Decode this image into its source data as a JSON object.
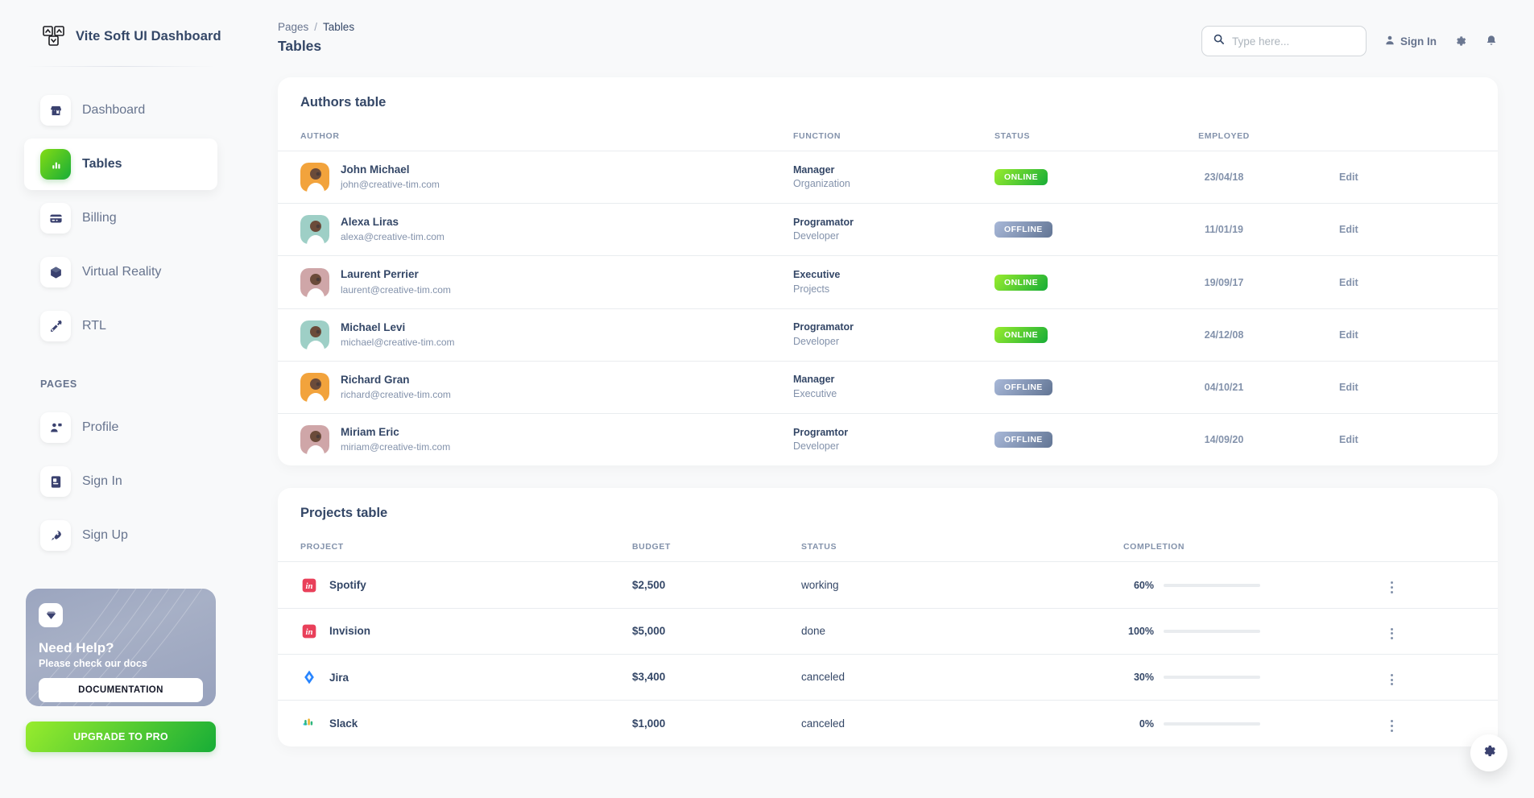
{
  "brand": {
    "name": "Vite Soft UI Dashboard",
    "logo_icon": "vite-logo-icon"
  },
  "sidebar": {
    "items": [
      {
        "label": "Dashboard",
        "icon": "shop-icon",
        "active": false
      },
      {
        "label": "Tables",
        "icon": "chart-bar-icon",
        "active": true
      },
      {
        "label": "Billing",
        "icon": "credit-card-icon",
        "active": false
      },
      {
        "label": "Virtual Reality",
        "icon": "box-3d-icon",
        "active": false
      },
      {
        "label": "RTL",
        "icon": "tools-icon",
        "active": false
      }
    ],
    "section_label": "PAGES",
    "pages": [
      {
        "label": "Profile",
        "icon": "profile-person-icon"
      },
      {
        "label": "Sign In",
        "icon": "document-sign-in-icon"
      },
      {
        "label": "Sign Up",
        "icon": "rocket-icon"
      }
    ],
    "help_card": {
      "icon": "diamond-icon",
      "title": "Need Help?",
      "subtitle": "Please check our docs",
      "button": "DOCUMENTATION"
    },
    "upgrade_button": "UPGRADE TO PRO"
  },
  "header": {
    "breadcrumb": {
      "root": "Pages",
      "separator": "/",
      "current": "Tables"
    },
    "page_title": "Tables",
    "search": {
      "placeholder": "Type here...",
      "value": "",
      "icon": "search-icon"
    },
    "sign_in_label": "Sign In",
    "settings_icon": "gear-icon",
    "notifications_icon": "bell-icon"
  },
  "authors_table": {
    "title": "Authors table",
    "columns": [
      "AUTHOR",
      "FUNCTION",
      "STATUS",
      "EMPLOYED",
      ""
    ],
    "action_label": "Edit",
    "rows": [
      {
        "name": "John Michael",
        "email": "john@creative-tim.com",
        "function": "Manager",
        "department": "Organization",
        "status": "ONLINE",
        "employed": "23/04/18",
        "avatar_bg": "#f2a33c"
      },
      {
        "name": "Alexa Liras",
        "email": "alexa@creative-tim.com",
        "function": "Programator",
        "department": "Developer",
        "status": "OFFLINE",
        "employed": "11/01/19",
        "avatar_bg": "#9ecfc6"
      },
      {
        "name": "Laurent Perrier",
        "email": "laurent@creative-tim.com",
        "function": "Executive",
        "department": "Projects",
        "status": "ONLINE",
        "employed": "19/09/17",
        "avatar_bg": "#cfa6a8"
      },
      {
        "name": "Michael Levi",
        "email": "michael@creative-tim.com",
        "function": "Programator",
        "department": "Developer",
        "status": "ONLINE",
        "employed": "24/12/08",
        "avatar_bg": "#9ecfc6"
      },
      {
        "name": "Richard Gran",
        "email": "richard@creative-tim.com",
        "function": "Manager",
        "department": "Executive",
        "status": "OFFLINE",
        "employed": "04/10/21",
        "avatar_bg": "#f2a33c"
      },
      {
        "name": "Miriam Eric",
        "email": "miriam@creative-tim.com",
        "function": "Programtor",
        "department": "Developer",
        "status": "OFFLINE",
        "employed": "14/09/20",
        "avatar_bg": "#cfa6a8"
      }
    ]
  },
  "projects_table": {
    "title": "Projects table",
    "columns": [
      "PROJECT",
      "BUDGET",
      "STATUS",
      "COMPLETION",
      ""
    ],
    "rows": [
      {
        "name": "Spotify",
        "icon": "invision-icon",
        "icon_color": "#e9405a",
        "budget": "$2,500",
        "status": "working",
        "completion": "60%",
        "value": 60,
        "bar": "info"
      },
      {
        "name": "Invision",
        "icon": "invision-icon",
        "icon_color": "#e9405a",
        "budget": "$5,000",
        "status": "done",
        "completion": "100%",
        "value": 100,
        "bar": "success"
      },
      {
        "name": "Jira",
        "icon": "jira-icon",
        "icon_color": "#2684ff",
        "budget": "$3,400",
        "status": "canceled",
        "completion": "30%",
        "value": 30,
        "bar": "danger"
      },
      {
        "name": "Slack",
        "icon": "slack-icon",
        "icon_color": "#36c5f0",
        "budget": "$1,000",
        "status": "canceled",
        "completion": "0%",
        "value": 0,
        "bar": "danger"
      }
    ]
  },
  "fab": {
    "icon": "gear-icon"
  },
  "colors": {
    "accent_green": "#98ec2d",
    "accent_green_dark": "#17ad37",
    "text_dark": "#344767",
    "text_muted": "#8392ab",
    "background": "#f8f9fa"
  }
}
